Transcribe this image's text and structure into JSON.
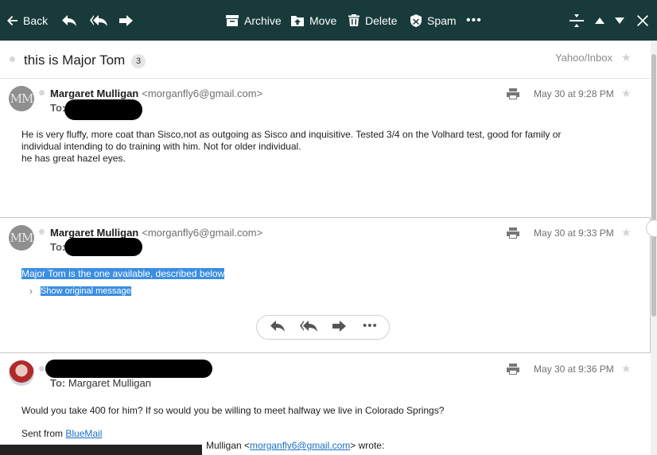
{
  "toolbar": {
    "back_label": "Back",
    "archive_label": "Archive",
    "move_label": "Move",
    "delete_label": "Delete",
    "spam_label": "Spam",
    "more_label": "•••"
  },
  "thread": {
    "subject": "this is Major Tom",
    "count": "3",
    "folder": "Yahoo/Inbox"
  },
  "messages": [
    {
      "sender_name": "Margaret Mulligan",
      "sender_email": "<morganfly6@gmail.com>",
      "avatar_initials": "MM",
      "to_label": "To:",
      "date": "May 30 at 9:28 PM",
      "body_lines": [
        "He is very fluffy, more coat than Sisco,not as outgoing as Sisco and inquisitive. Tested 3/4 on the Volhard test, good for family or",
        "individual intending to do training with him. Not for older individual.",
        "he has great hazel eyes."
      ]
    },
    {
      "sender_name": "Margaret Mulligan",
      "sender_email": "<morganfly6@gmail.com>",
      "avatar_initials": "MM",
      "to_label": "To:",
      "date": "May 30 at 9:33 PM",
      "body_lines": [
        "Major Tom is the one available, described below"
      ],
      "show_original": "Show original message"
    },
    {
      "to_label": "To:",
      "to_name": "Margaret Mulligan",
      "date": "May 30 at 9:36 PM",
      "body_lines": [
        "Would you take 400 for him? If so would you be willing to meet halfway we live in Colorado Springs?"
      ],
      "sent_from_prefix": "Sent from ",
      "sent_from_link": "BlueMail",
      "quote_name": "Mulligan <",
      "quote_email": "morganfly6@gmail.com",
      "quote_suffix": "> wrote:"
    }
  ],
  "icons": {
    "back": "arrow-left-icon",
    "reply": "reply-icon",
    "reply_all": "reply-all-icon",
    "forward": "forward-icon",
    "archive": "archive-icon",
    "move": "move-icon",
    "delete": "trash-icon",
    "spam": "shield-icon",
    "collapse": "collapse-icon",
    "prev": "up-icon",
    "next": "down-icon",
    "close": "close-icon",
    "print": "printer-icon",
    "star": "star-icon"
  },
  "colors": {
    "toolbar_bg": "#183a3a",
    "selection": "#3b8ee0",
    "link": "#1a6fc7"
  }
}
